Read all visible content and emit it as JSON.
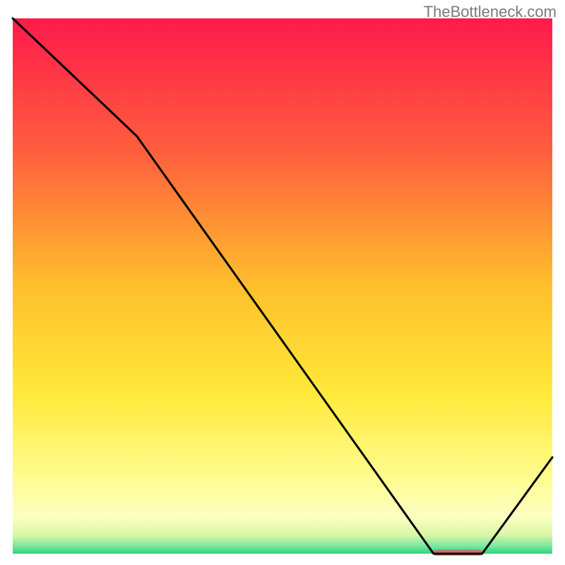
{
  "watermark": "TheBottleneck.com",
  "chart_data": {
    "type": "line",
    "title": "",
    "xlabel": "",
    "ylabel": "",
    "xlim": [
      0,
      100
    ],
    "ylim": [
      0,
      100
    ],
    "x": [
      0,
      23,
      78,
      87,
      100
    ],
    "values": [
      100,
      78,
      0,
      0,
      18
    ],
    "plateau_marker": {
      "x_start": 78,
      "x_end": 87,
      "y": 0.2,
      "color": "#c96f6a"
    },
    "background_gradient_stops": [
      {
        "offset": 0.0,
        "color": "#ff1a4b"
      },
      {
        "offset": 0.25,
        "color": "#ff5f3e"
      },
      {
        "offset": 0.5,
        "color": "#ffbf2c"
      },
      {
        "offset": 0.7,
        "color": "#ffe93a"
      },
      {
        "offset": 0.85,
        "color": "#fffb8a"
      },
      {
        "offset": 0.93,
        "color": "#fdffc1"
      },
      {
        "offset": 0.965,
        "color": "#d8f7a6"
      },
      {
        "offset": 0.985,
        "color": "#7de8a0"
      },
      {
        "offset": 1.0,
        "color": "#2fd47e"
      }
    ],
    "line_color": "#000000",
    "line_width": 3
  }
}
